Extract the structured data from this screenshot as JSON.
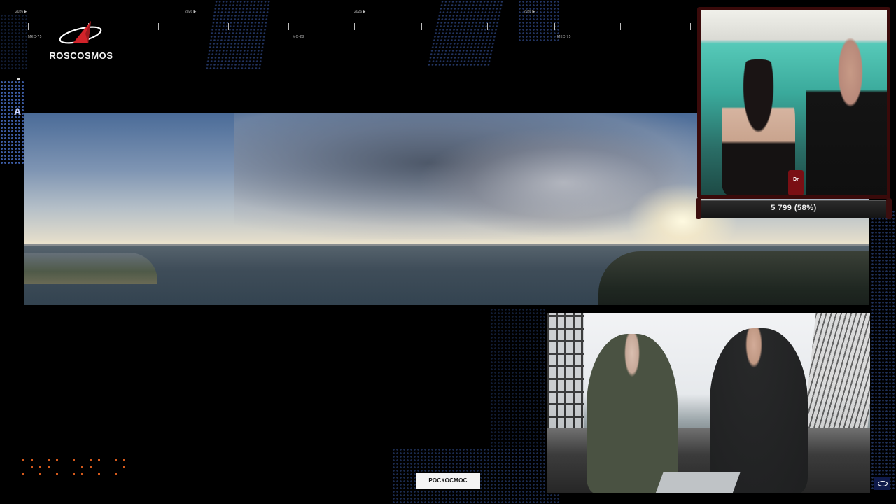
{
  "logo": {
    "text": "ROSCOSMOS"
  },
  "timeline": {
    "top_labels": [
      "2026 ▶",
      "2026 ▶",
      "2026 ▶",
      "2026 ▶"
    ],
    "tick_labels": [
      "МКС-75",
      "МС-28",
      "МКС-75"
    ]
  },
  "side_marker": "A",
  "webcam": {
    "counter": "5 799 (58%)",
    "can_label": "Dr"
  },
  "watermark": "РОСКОСМОС",
  "colors": {
    "background": "#000000",
    "accent_blue": "#3d5fb0",
    "dot_orange": "#d55a1c",
    "webcam_frame": "#3a0a0a"
  }
}
